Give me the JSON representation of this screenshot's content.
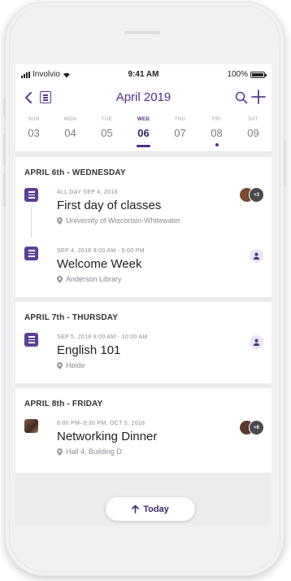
{
  "status": {
    "carrier": "Involvio",
    "time": "9:41 AM",
    "battery": "100%"
  },
  "header": {
    "month": "April 2019"
  },
  "week": [
    {
      "dow": "SUN",
      "num": "03"
    },
    {
      "dow": "MON",
      "num": "04"
    },
    {
      "dow": "TUE",
      "num": "05"
    },
    {
      "dow": "WED",
      "num": "06"
    },
    {
      "dow": "THU",
      "num": "07"
    },
    {
      "dow": "FRI",
      "num": "08"
    },
    {
      "dow": "SAT",
      "num": "09"
    }
  ],
  "sections": [
    {
      "title": "APRIL 6th - WEDNESDAY",
      "events": [
        {
          "meta": "ALL DAY SEP 4, 2018",
          "title": "First day of classes",
          "location": "University of Wisconsin-Whitewater",
          "attendee_badge": "+3"
        },
        {
          "meta": "SEP 4, 2018 9:00 AM - 5:00 PM",
          "title": "Welcome Week",
          "location": "Anderson Library"
        }
      ]
    },
    {
      "title": "APRIL 7th - THURSDAY",
      "events": [
        {
          "meta": "SEP 5, 2018 9:00 AM - 10:00 AM",
          "title": "English 101",
          "location": "Heide"
        }
      ]
    },
    {
      "title": "APRIL 8th - FRIDAY",
      "events": [
        {
          "meta": "8:00 PM–9:30 PM, OCT 5, 2018",
          "title": "Networking Dinner",
          "location": "Hall 4, Building D",
          "attendee_badge": "+6"
        }
      ]
    }
  ],
  "today_button": "Today",
  "colors": {
    "accent": "#4e2f88",
    "event_icon": "#5b3f98",
    "background": "#ececee"
  }
}
